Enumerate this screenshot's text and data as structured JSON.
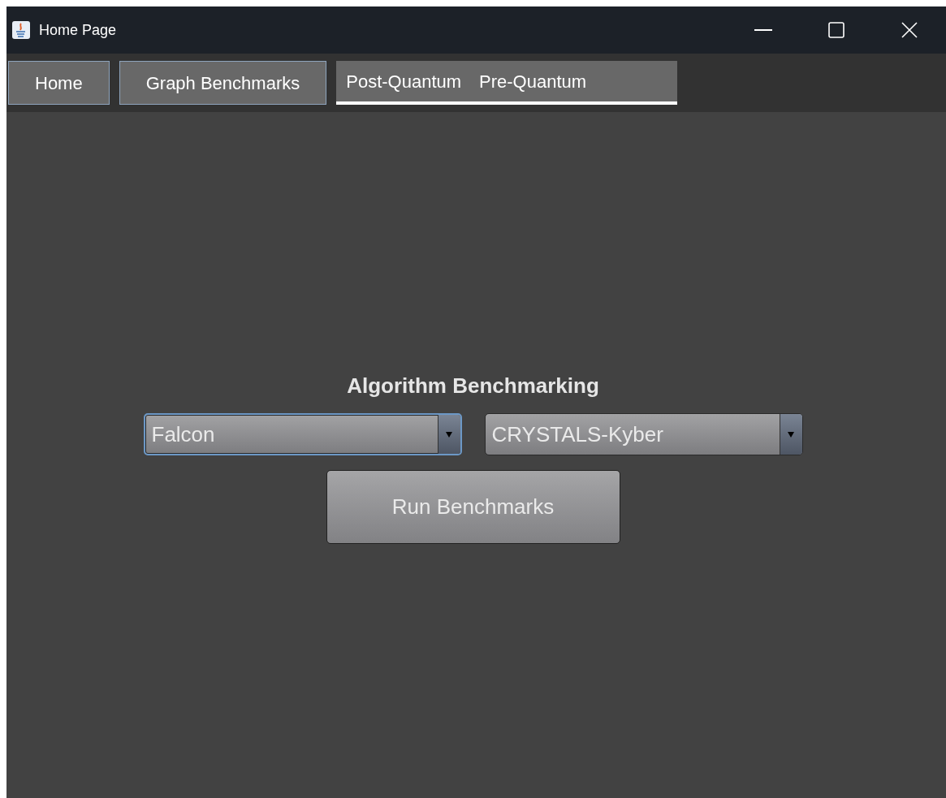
{
  "window": {
    "title": "Home Page"
  },
  "toolbar": [
    {
      "kind": "button",
      "label": "Home"
    },
    {
      "kind": "button",
      "label": "Graph Benchmarks"
    },
    {
      "kind": "menus",
      "selected": true,
      "items": [
        "Post-Quantum",
        "Pre-Quantum"
      ]
    }
  ],
  "main": {
    "heading": "Algorithm Benchmarking",
    "dropdowns": [
      {
        "value": "Falcon",
        "focused": true
      },
      {
        "value": "CRYSTALS-Kyber",
        "focused": false
      }
    ],
    "button": "Run Benchmarks"
  }
}
